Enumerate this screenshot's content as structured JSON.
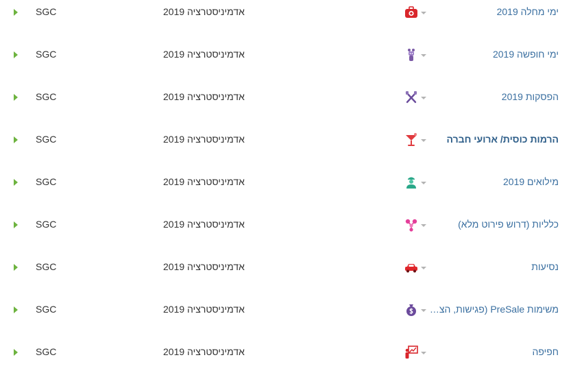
{
  "rows": [
    {
      "task": "ימי מחלה 2019",
      "project": "אדמיניסטרציה 2019",
      "client": "SGC",
      "icon": "first-aid-kit-icon",
      "color": "#d9262b"
    },
    {
      "task": "ימי חופשה 2019",
      "project": "אדמיניסטרציה 2019",
      "client": "SGC",
      "icon": "robot-icon",
      "color": "#7b5aa6"
    },
    {
      "task": "הפסקות 2019",
      "project": "אדמיניסטרציה 2019",
      "client": "SGC",
      "icon": "fork-knife-icon",
      "color": "#6a4c9c"
    },
    {
      "task": "הרמות כוסית/ ארועי חברה",
      "project": "אדמיניסטרציה 2019",
      "client": "SGC",
      "icon": "cocktail-glass-icon",
      "color": "#e03a3e"
    },
    {
      "task": "מילואים 2019",
      "project": "אדמיניסטרציה 2019",
      "client": "SGC",
      "icon": "soldier-icon",
      "color": "#2aa889"
    },
    {
      "task": "כלליות (דרוש פירוט מלא)",
      "project": "אדמיניסטרציה 2019",
      "client": "SGC",
      "icon": "molecule-icon",
      "color": "#e43f9a"
    },
    {
      "task": "נסיעות",
      "project": "אדמיניסטרציה 2019",
      "client": "SGC",
      "icon": "car-icon",
      "color": "#e0262b"
    },
    {
      "task": "משימות PreSale (פגישות, הצעות מחיר)",
      "project": "אדמיניסטרציה 2019",
      "client": "SGC",
      "icon": "money-bag-icon",
      "color": "#6b4a9c"
    },
    {
      "task": "חפיפה",
      "project": "אדמיניסטרציה 2019",
      "client": "SGC",
      "icon": "presentation-icon",
      "color": "#d9262b"
    }
  ]
}
